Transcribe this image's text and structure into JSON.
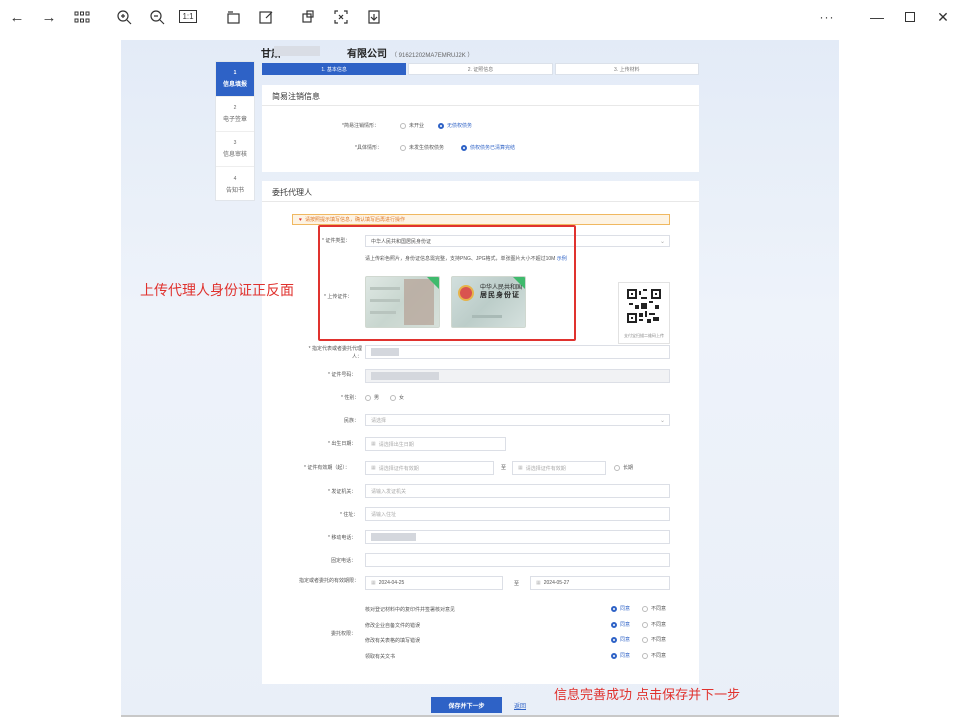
{
  "toolbar": {
    "icons": [
      "back-arrow-icon",
      "forward-arrow-icon",
      "grid-icon",
      "zoom-in-icon",
      "zoom-out-icon",
      "actual-size-icon",
      "rotate-icon",
      "edit-icon",
      "crop-icon",
      "scan-icon",
      "download-icon",
      "more-icon",
      "minimize-icon",
      "maximize-icon",
      "close-icon"
    ],
    "actual_size": "1:1",
    "more": "···"
  },
  "page": {
    "company_prefix": "甘肃",
    "company_suffix": "有限公司",
    "company_code": "（ 91621202MA7EMRUJ2K ）"
  },
  "steps": [
    "1. 基本信息",
    "2. 证照信息",
    "3. 上传材料"
  ],
  "sidenav": [
    {
      "num": "1",
      "label": "信息填报"
    },
    {
      "num": "2",
      "label": "电子签章"
    },
    {
      "num": "3",
      "label": "信息审核"
    },
    {
      "num": "4",
      "label": "告知书"
    }
  ],
  "simple_section": {
    "title": "简易注销信息",
    "row1": {
      "label": "*简易注销情形：",
      "opt1": "未开业",
      "opt2": "无债权债务"
    },
    "row2": {
      "label": "*具体情形：",
      "opt1": "未发生债权债务",
      "opt2": "债权债务已清算完结"
    }
  },
  "agent_section": {
    "title": "委托代理人",
    "warning": "请按照提示填写信息，确认填写后再进行操作",
    "id_type": {
      "label": "* 证件类型：",
      "value": "中华人民共和国居民身份证"
    },
    "upload_hint": "请上传彩色照片，身份证信息需完整，支持PNG、JPG格式，单张图片大小不超过10M",
    "upload_hint_link": "示例",
    "upload": {
      "label": "* 上传证件：",
      "back_title": "中华人民共和国",
      "back_sub": "居民身份证"
    },
    "qr_caption": "支付宝扫描二维码上传",
    "name": {
      "label": "* 指定代表或者委托代理人："
    },
    "id_no": {
      "label": "* 证件号码："
    },
    "gender": {
      "label": "* 性别：",
      "opt1": "男",
      "opt2": "女"
    },
    "ethnic": {
      "label": "民族：",
      "placeholder": "请选择"
    },
    "birth": {
      "label": "* 出生日期：",
      "placeholder": "请选择出生日期"
    },
    "validity": {
      "label": "* 证件有效期（起）：",
      "start": "请选择证件有效期",
      "to": "至",
      "end": "请选择证件有效期",
      "long": "长期"
    },
    "issuer": {
      "label": "* 发证机关：",
      "placeholder": "请输入发证机关"
    },
    "address": {
      "label": "* 住址：",
      "placeholder": "请输入住址"
    },
    "mobile": {
      "label": "* 移动电话："
    },
    "phone": {
      "label": "固定电话："
    },
    "period": {
      "label": "指定或者委托的有效期限：",
      "start": "2024-04-25",
      "to": "至",
      "end": "2024-05-27"
    },
    "auth": {
      "label": "委托权限：",
      "items": [
        "核对登记材料中的复印件并签署核对意见",
        "修改企业自备文件的错误",
        "修改有关表格的填写错误",
        "领取有关文书"
      ],
      "agree": "同意",
      "disagree": "不同意"
    }
  },
  "actions": {
    "save": "保存并下一步",
    "back": "返回"
  },
  "annotations": {
    "upload_note": "上传代理人身份证正反面",
    "save_note": "信息完善成功  点击保存并下一步"
  },
  "colors": {
    "accent": "#2e62c6",
    "annotation": "#e0322e"
  }
}
